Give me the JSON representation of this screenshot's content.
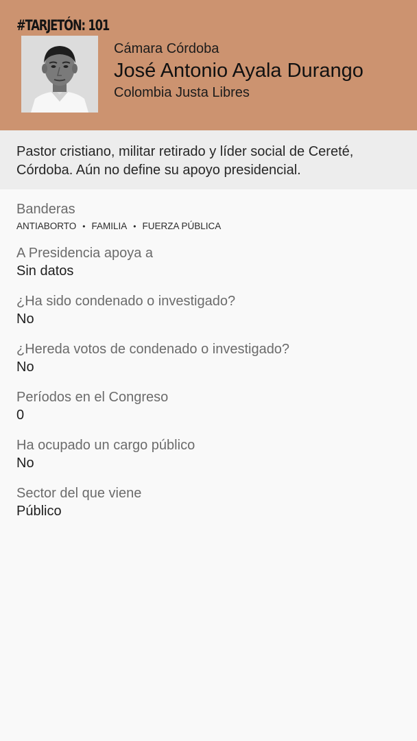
{
  "header": {
    "tag": "#TARJETÓN: 101",
    "chamber": "Cámara Córdoba",
    "name": "José Antonio Ayala Durango",
    "party": "Colombia Justa Libres",
    "background_color": "#cc9370"
  },
  "photo": {
    "icon": "candidate-portrait"
  },
  "bio": "Pastor cristiano, militar retirado y líder social de Cereté, Córdoba. Aún no define su apoyo presidencial.",
  "banderas": {
    "label": "Banderas",
    "items": [
      "ANTIABORTO",
      "FAMILIA",
      "FUERZA PÚBLICA"
    ]
  },
  "fields": [
    {
      "label": "A Presidencia apoya a",
      "value": "Sin datos"
    },
    {
      "label": "¿Ha sido condenado o investigado?",
      "value": "No"
    },
    {
      "label": "¿Hereda votos de condenado o investigado?",
      "value": "No"
    },
    {
      "label": "Períodos en el Congreso",
      "value": "0"
    },
    {
      "label": "Ha ocupado un cargo público",
      "value": "No"
    },
    {
      "label": "Sector del que viene",
      "value": "Público"
    }
  ]
}
